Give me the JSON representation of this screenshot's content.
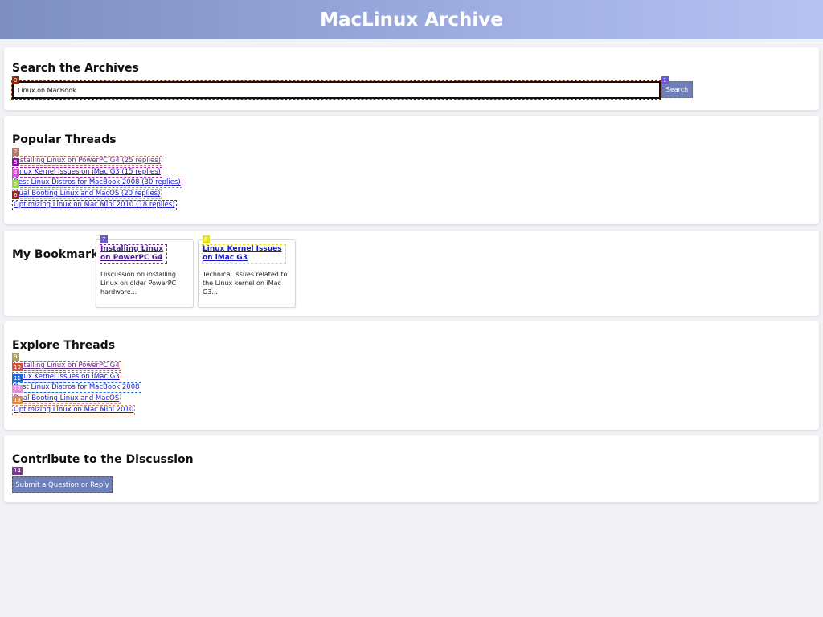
{
  "header": {
    "title": "MacLinux Archive"
  },
  "search": {
    "heading": "Search the Archives",
    "value": "Linux on MacBook",
    "button_label": "Search"
  },
  "popular": {
    "heading": "Popular Threads",
    "links": [
      "Installing Linux on PowerPC G4 (25 replies)",
      "Linux Kernel Issues on iMac G3 (15 replies)",
      "Best Linux Distros for MacBook 2008 (30 replies)",
      "Dual Booting Linux and MacOS (20 replies)",
      "Optimizing Linux on Mac Mini 2010 (18 replies)"
    ]
  },
  "bookmarks": {
    "heading": "My Bookmarks",
    "cards": [
      {
        "title": "Installing Linux on PowerPC G4",
        "description": "Discussion on installing Linux on older PowerPC hardware..."
      },
      {
        "title": "Linux Kernel Issues on iMac G3",
        "description": "Technical issues related to the Linux kernel on iMac G3..."
      }
    ]
  },
  "explore": {
    "heading": "Explore Threads",
    "links": [
      "Installing Linux on PowerPC G4",
      "Linux Kernel Issues on iMac G3",
      "Best Linux Distros for MacBook 2008",
      "Dual Booting Linux and MacOS",
      "Optimizing Linux on Mac Mini 2010"
    ]
  },
  "contribute": {
    "heading": "Contribute to the Discussion",
    "button_label": "Submit a Question or Reply"
  },
  "labels": [
    "0",
    "1",
    "2",
    "3",
    "4",
    "5",
    "6",
    "7",
    "8",
    "9",
    "10",
    "11",
    "12",
    "13",
    "14"
  ],
  "colors": {
    "header_gradient_start": "#7d8ec1",
    "header_gradient_end": "#b7c2f2",
    "button": "#6f80b8",
    "link": "#1a1ac8",
    "page_background": "#f2f2f6"
  }
}
